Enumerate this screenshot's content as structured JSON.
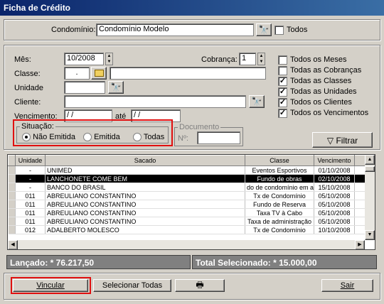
{
  "window": {
    "title": "Ficha de Crédito"
  },
  "condominio": {
    "label": "Condomínio:",
    "value": "Condomínio Modelo",
    "todos_label": "Todos"
  },
  "filters": {
    "mes_label": "Mês:",
    "mes_value": "10/2008",
    "cobranca_label": "Cobrança:",
    "cobranca_value": "1",
    "classe_label": "Classe:",
    "classe_value": ".",
    "unidade_label": "Unidade",
    "cliente_label": "Cliente:",
    "vencimento_label": "Vencimento:",
    "vencimento_from": " / /",
    "ate_label": "até",
    "vencimento_to": " / /"
  },
  "checks": [
    {
      "label": "Todos os Meses",
      "checked": false
    },
    {
      "label": "Todas as Cobranças",
      "checked": false
    },
    {
      "label": "Todas as Classes",
      "checked": true
    },
    {
      "label": "Todas as Unidades",
      "checked": true
    },
    {
      "label": "Todos os Clientes",
      "checked": true
    },
    {
      "label": "Todos os Vencimentos",
      "checked": true
    }
  ],
  "situacao": {
    "legend": "Situação:",
    "options": [
      "Não Emitida",
      "Emitida",
      "Todas"
    ],
    "selected": "Não Emitida"
  },
  "documento": {
    "legend": "Documento",
    "no_label": "Nº:"
  },
  "filtrar_label": "Filtrar",
  "table": {
    "columns": [
      "Unidade",
      "Sacado",
      "Classe",
      "Vencimento"
    ],
    "rows": [
      [
        "-",
        "UNIMED",
        "Eventos Esportivos",
        "01/10/2008"
      ],
      [
        "-",
        "LANCHONETE COME BEM",
        "Fundo de obras",
        "02/10/2008"
      ],
      [
        "-",
        "BANCO DO BRASIL",
        "do de condomínio em a",
        "15/10/2008"
      ],
      [
        "011",
        "ABREULIANO CONSTANTINO",
        "Tx de Condomínio",
        "05/10/2008"
      ],
      [
        "011",
        "ABREULIANO CONSTANTINO",
        "Fundo de Reserva",
        "05/10/2008"
      ],
      [
        "011",
        "ABREULIANO CONSTANTINO",
        "Taxa TV à Cabo",
        "05/10/2008"
      ],
      [
        "011",
        "ABREULIANO CONSTANTINO",
        "Taxa de administração",
        "05/10/2008"
      ],
      [
        "012",
        "ADALBERTO MOLESCO",
        "Tx de Condomínio",
        "10/10/2008"
      ]
    ],
    "selected_row": 1
  },
  "status": {
    "lancado": "Lançado: * 76.217,50",
    "total": "Total Selecionado: * 15.000,00"
  },
  "buttons": {
    "vincular": "Vincular",
    "selecionar": "Selecionar Todas",
    "sair": "Sair"
  },
  "icons": {
    "search": "binoculars-icon",
    "folder": "folder-icon",
    "print": "printer-icon",
    "filter": "funnel-icon"
  }
}
